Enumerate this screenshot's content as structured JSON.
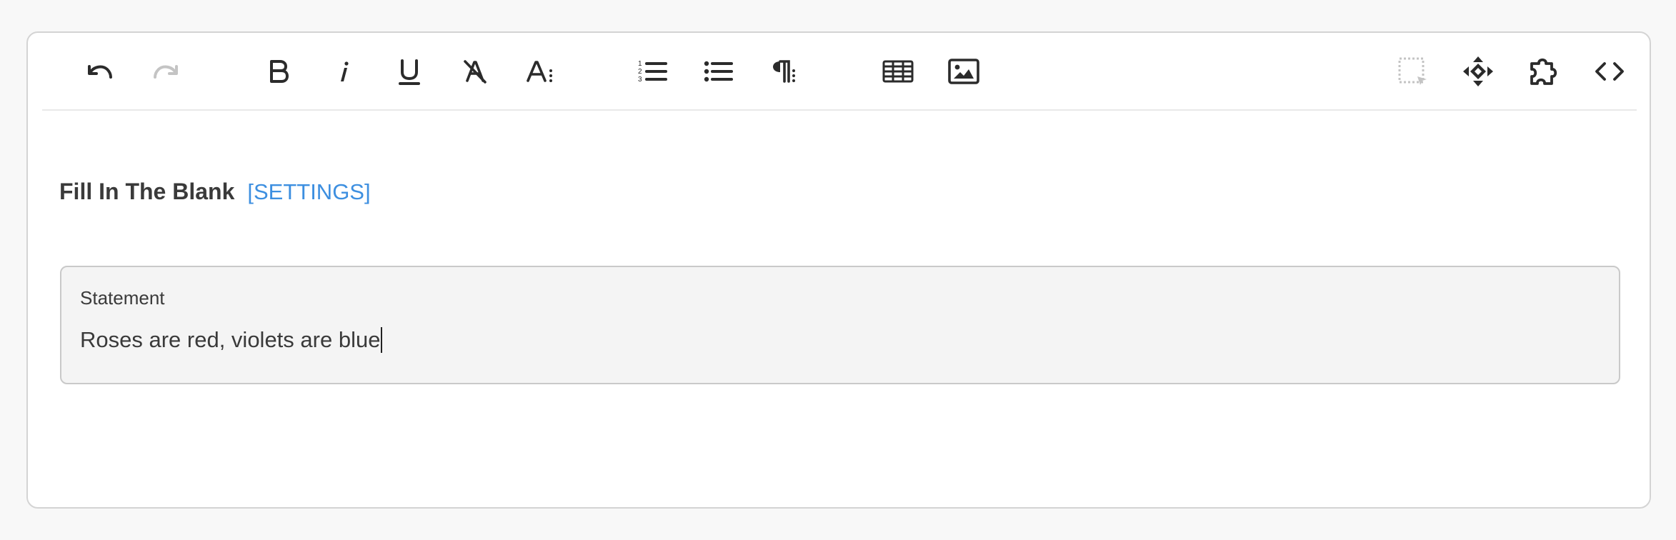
{
  "toolbar": {
    "buttons": [
      {
        "id": "undo",
        "icon": "undo-icon",
        "enabled": true
      },
      {
        "id": "redo",
        "icon": "redo-icon",
        "enabled": false
      },
      {
        "id": "bold",
        "icon": "bold-icon",
        "enabled": true
      },
      {
        "id": "italic",
        "icon": "italic-icon",
        "enabled": true
      },
      {
        "id": "underline",
        "icon": "underline-icon",
        "enabled": true
      },
      {
        "id": "clear-formatting",
        "icon": "clear-formatting-icon",
        "enabled": true
      },
      {
        "id": "text-style-menu",
        "icon": "text-style-menu-icon",
        "enabled": true
      },
      {
        "id": "ordered-list",
        "icon": "ordered-list-icon",
        "enabled": true
      },
      {
        "id": "bullet-list",
        "icon": "bullet-list-icon",
        "enabled": true
      },
      {
        "id": "paragraph-menu",
        "icon": "paragraph-menu-icon",
        "enabled": true
      },
      {
        "id": "table",
        "icon": "table-icon",
        "enabled": true
      },
      {
        "id": "image",
        "icon": "image-icon",
        "enabled": true
      },
      {
        "id": "select-block",
        "icon": "select-block-icon",
        "enabled": false
      },
      {
        "id": "move",
        "icon": "move-icon",
        "enabled": true
      },
      {
        "id": "plugin",
        "icon": "puzzle-icon",
        "enabled": true
      },
      {
        "id": "source-code",
        "icon": "code-icon",
        "enabled": true
      }
    ]
  },
  "block": {
    "title": "Fill In The Blank",
    "settings_label": "[SETTINGS]",
    "statement_label": "Statement",
    "statement_value": "Roses are red, violets are blue"
  },
  "colors": {
    "accent": "#3d8fe0",
    "icon": "#2b2b2b",
    "icon_disabled": "#c4c4c4",
    "box_bg": "#f4f4f4",
    "text": "#3a3a3a"
  }
}
